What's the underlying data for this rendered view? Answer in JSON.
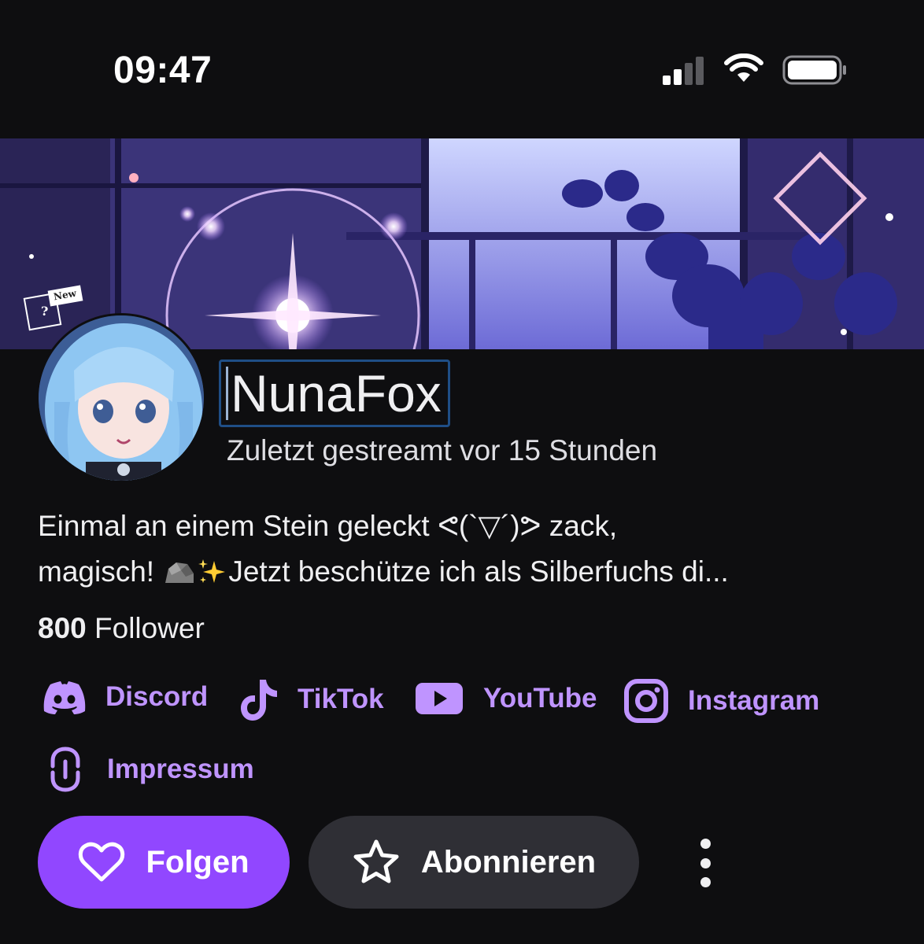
{
  "status_bar": {
    "time": "09:47",
    "icons": [
      "cellular-signal-icon",
      "wifi-icon",
      "battery-icon"
    ]
  },
  "banner": {
    "badge_text": "New",
    "badge_symbol": "?"
  },
  "channel": {
    "name": "NunaFox",
    "last_streamed": "Zuletzt gestreamt vor 15 Stunden",
    "bio_line1": "Einmal an einem Stein geleckt ᕙ(`▽´)ᕗ zack,",
    "bio_line2_start": "magisch! ",
    "bio_line2_end": "Jetzt beschütze ich als Silberfuchs di...",
    "followers_count": "800",
    "followers_label": "Follower"
  },
  "social_links": [
    {
      "label": "Discord",
      "icon": "discord-icon"
    },
    {
      "label": "TikTok",
      "icon": "tiktok-icon"
    },
    {
      "label": "YouTube",
      "icon": "youtube-icon"
    },
    {
      "label": "Instagram",
      "icon": "instagram-icon"
    },
    {
      "label": "Impressum",
      "icon": "link-icon"
    }
  ],
  "actions": {
    "follow_label": "Folgen",
    "subscribe_label": "Abonnieren",
    "more_icon": "more-vertical-icon"
  },
  "colors": {
    "background": "#0e0e10",
    "accent": "#9147ff",
    "link": "#bf94ff",
    "secondary_button": "#2f2f35"
  }
}
